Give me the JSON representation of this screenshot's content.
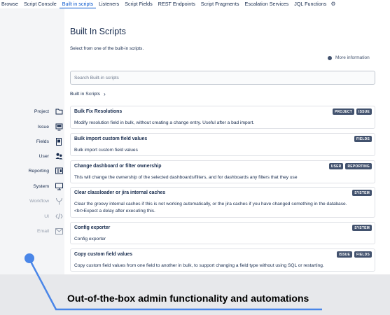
{
  "nav": {
    "tabs": [
      {
        "label": "Browse"
      },
      {
        "label": "Script Console"
      },
      {
        "label": "Built in scripts",
        "active": true
      },
      {
        "label": "Listeners"
      },
      {
        "label": "Script Fields"
      },
      {
        "label": "REST Endpoints"
      },
      {
        "label": "Script Fragments"
      },
      {
        "label": "Escalation Services"
      },
      {
        "label": "JQL Functions"
      }
    ],
    "settings_icon": "gear-icon"
  },
  "page": {
    "title": "Built In Scripts",
    "subtitle": "Select from one of the built-in scripts.",
    "more_info": "More information",
    "search_placeholder": "Search Built-in scripts",
    "breadcrumb": "Built in Scripts"
  },
  "sidebar": {
    "items": [
      {
        "label": "Project",
        "icon": "folder-icon",
        "enabled": true
      },
      {
        "label": "Issue",
        "icon": "monitor-icon",
        "enabled": true
      },
      {
        "label": "Fields",
        "icon": "field-icon",
        "enabled": true
      },
      {
        "label": "User",
        "icon": "users-icon",
        "enabled": true
      },
      {
        "label": "Reporting",
        "icon": "reporting-icon",
        "enabled": true
      },
      {
        "label": "System",
        "icon": "system-icon",
        "enabled": true
      },
      {
        "label": "Workflow",
        "icon": "workflow-icon",
        "enabled": false
      },
      {
        "label": "UI",
        "icon": "code-icon",
        "enabled": false
      },
      {
        "label": "Email",
        "icon": "email-icon",
        "enabled": false
      }
    ]
  },
  "scripts": [
    {
      "title": "Bulk Fix Resolutions",
      "description": "Modify resolution field in bulk, without creating a change entry. Useful after a bad import.",
      "badges": [
        "PROJECT",
        "ISSUE"
      ]
    },
    {
      "title": "Bulk import custom field values",
      "description": "Bulk import custom field values",
      "badges": [
        "FIELDS"
      ]
    },
    {
      "title": "Change dashboard or filter ownership",
      "description": "This will change the ownership of the selected dashboards/filters, and for dashboards any filters that they use",
      "badges": [
        "USER",
        "REPORTING"
      ]
    },
    {
      "title": "Clear classloader or jira internal caches",
      "description": "Clear the groovy internal caches if this is not working automatically, or the jira caches if you have changed something in the database.<br>Expect a delay after executing this.",
      "badges": [
        "SYSTEM"
      ]
    },
    {
      "title": "Config exporter",
      "description": "Config exporter",
      "badges": [
        "SYSTEM"
      ]
    },
    {
      "title": "Copy custom field values",
      "description": "Copy custom field values from one field to another in bulk, to support changing a field type without using SQL or restarting.",
      "badges": [
        "ISSUE",
        "FIELDS"
      ]
    }
  ],
  "banner": {
    "text": "Out-of-the-box admin functionality and automations"
  },
  "colors": {
    "accent": "#0052cc",
    "badge": "#42526e",
    "callout": "#4a86e8",
    "banner_bg": "#e7e8eb"
  }
}
